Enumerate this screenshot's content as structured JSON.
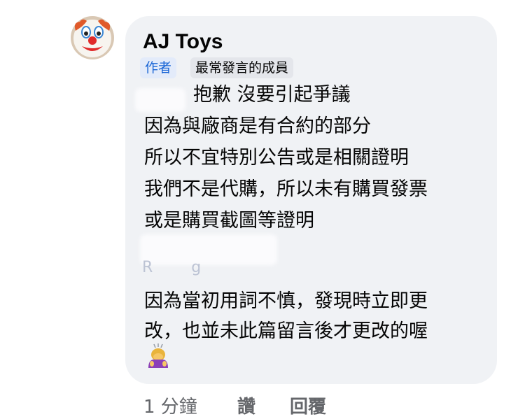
{
  "comment": {
    "author": "AJ Toys",
    "badges": {
      "author": "作者",
      "top_commenter": "最常發言的成員"
    },
    "lines": [
      "抱歉 沒要引起爭議",
      "因為與廠商是有合約的部分",
      "所以不宜特別公告或是相關證明",
      "我們不是代購，所以未有購買發票",
      "或是購買截圖等證明",
      "因為當初用詞不慎，發現時立即更",
      "改，也並未此篇留言後才更改的喔"
    ]
  },
  "actions": {
    "timestamp": "1 分鐘",
    "like": "讚",
    "reply": "回覆"
  },
  "colors": {
    "bubble": "#f0f2f5",
    "author_badge_text": "#1a66d6",
    "author_badge_bg": "#e3ebfa",
    "meta_text": "#65676b"
  },
  "icons": {
    "avatar": "clown-face-icon",
    "emoji": "person-bowing-icon"
  }
}
